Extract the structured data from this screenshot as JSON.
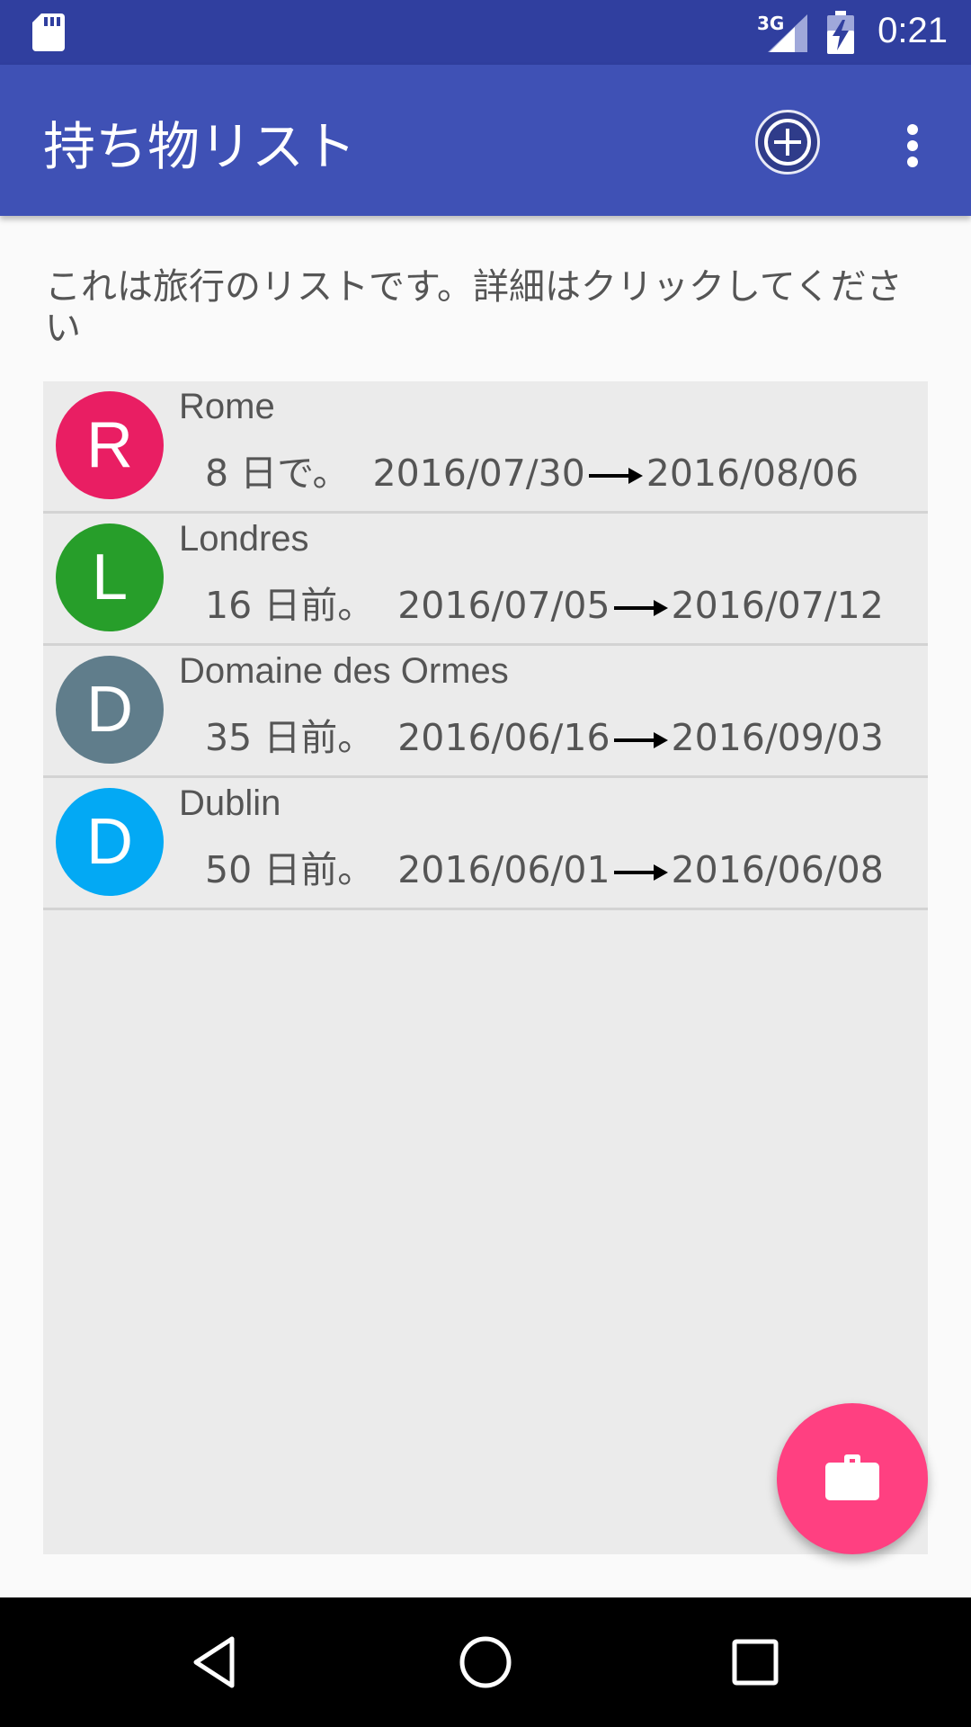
{
  "status_bar": {
    "network": "3G",
    "time": "0:21",
    "icons": [
      "sd-card-icon",
      "signal-icon",
      "battery-charging-icon"
    ]
  },
  "app_bar": {
    "title": "持ち物リスト",
    "actions": [
      "add-circle-icon",
      "more-vert-icon"
    ]
  },
  "description": "これは旅行のリストです。詳細はクリックしてください",
  "trips": [
    {
      "initial": "R",
      "name": "Rome",
      "relative": "8 日で。",
      "start": "2016/07/30",
      "end": "2016/08/06",
      "color": "#e91e63"
    },
    {
      "initial": "L",
      "name": "Londres",
      "relative": "16 日前。",
      "start": "2016/07/05",
      "end": "2016/07/12",
      "color": "#279e2a"
    },
    {
      "initial": "D",
      "name": "Domaine des Ormes",
      "relative": "35 日前。",
      "start": "2016/06/16",
      "end": "2016/09/03",
      "color": "#607d8b"
    },
    {
      "initial": "D",
      "name": "Dublin",
      "relative": "50 日前。",
      "start": "2016/06/01",
      "end": "2016/06/08",
      "color": "#03a9f4"
    }
  ],
  "fab": {
    "icon": "briefcase-icon",
    "color": "#ff4081"
  },
  "nav_bar": {
    "icons": [
      "back-icon",
      "home-icon",
      "recents-icon"
    ]
  },
  "colors": {
    "status_bar": "#303f9f",
    "app_bar": "#3f51b5",
    "list_background": "#ebebeb"
  }
}
